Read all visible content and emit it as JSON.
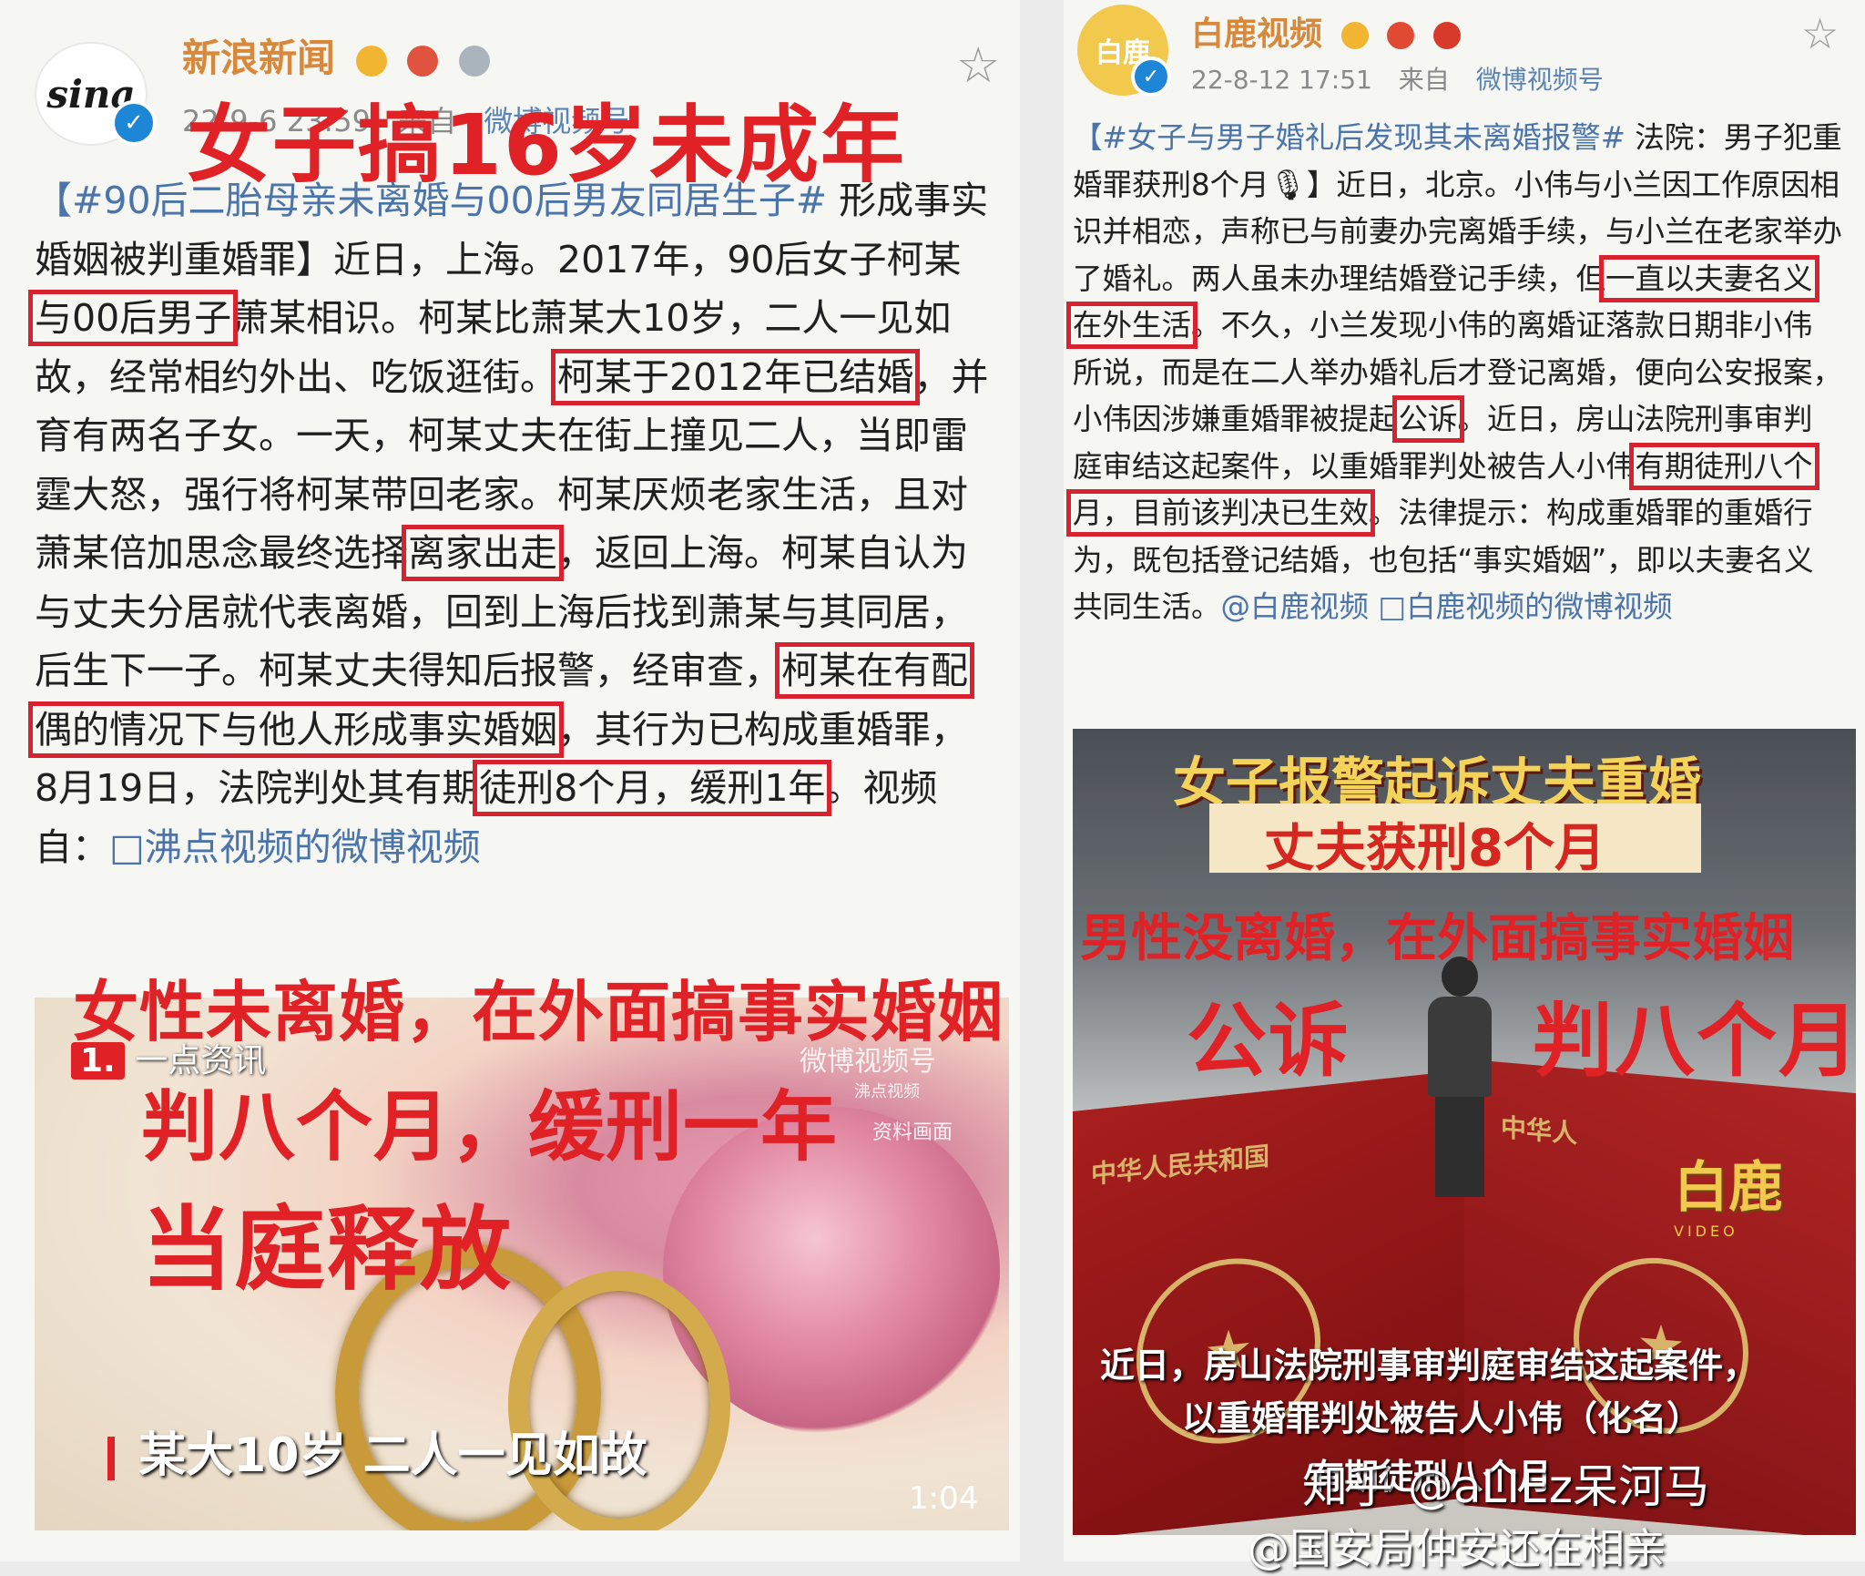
{
  "left_post": {
    "account_name": "新浪新闻",
    "avatar_logo_text": "sina",
    "meta_time": "22-9-6 23:59",
    "meta_from": "来自",
    "meta_source": "微博视频号",
    "overlay_title": "女子搞16岁未成年",
    "text_segments": [
      {
        "t": "【#90后二胎母亲未离婚与00后男友同居生子#",
        "cls": "tag"
      },
      {
        "t": " 形成事实婚姻被判重婚罪】近日，上海。2017年，90后女子柯某"
      },
      {
        "t": "与00后男子",
        "cls": "hl"
      },
      {
        "t": "萧某相识。柯某比萧某大10岁，二人一见如故，经常相约外出、吃饭逛街。"
      },
      {
        "t": "柯某于2012年已结婚",
        "cls": "hl"
      },
      {
        "t": "，并育有两名子女。一天，柯某丈夫在街上撞见二人，当即雷霆大怒，强行将柯某带回老家。柯某厌烦老家生活，且对萧某倍加思念最终选择"
      },
      {
        "t": "离家出走",
        "cls": "hl"
      },
      {
        "t": "，返回上海。柯某自认为与丈夫分居就代表离婚，回到上海后找到萧某与其同居，后生下一子。柯某丈夫得知后报警，经审查，"
      },
      {
        "t": "柯某在有配偶的情况下与他人形成事实婚姻",
        "cls": "hl"
      },
      {
        "t": "，其行为已构成重婚罪，8月19日，法院判处其有期"
      },
      {
        "t": "徒刑8个月，缓刑1年",
        "cls": "hl"
      },
      {
        "t": "。视频自："
      },
      {
        "t": "□沸点视频的微博视频",
        "cls": "link"
      }
    ],
    "overlay_1": "女性未离婚，在外面搞事实婚姻",
    "overlay_2": "判八个月，缓刑一年",
    "overlay_3": "当庭释放",
    "video": {
      "top_badge_num": "1.",
      "top_badge_text": "一点资讯",
      "watermark": "微博视频号",
      "watermark_sub": "沸点视频",
      "source_note": "资料画面",
      "subtitle": "某大10岁 二人一见如故",
      "duration": "1:04"
    }
  },
  "right_post": {
    "account_name": "白鹿视频",
    "avatar_logo_text": "白鹿",
    "meta_time": "22-8-12 17:51",
    "meta_from": "来自",
    "meta_source": "微博视频号",
    "text_segments": [
      {
        "t": "【#女子与男子婚礼后发现其未离婚报警#",
        "cls": "tag"
      },
      {
        "t": " 法院：男子犯重婚罪获刑8个月🎙】近日，北京。小伟与小兰因工作原因相识并相恋，声称已与前妻办完离婚手续，与小兰在老家举办了婚礼。两人虽未办理结婚登记手续，但"
      },
      {
        "t": "一直以夫妻名义在外生活",
        "cls": "hl"
      },
      {
        "t": "。不久，小兰发现小伟的离婚证落款日期非小伟所说，而是在二人举办婚礼后才登记离婚，便向公安报案，小伟因涉嫌重婚罪被提起"
      },
      {
        "t": "公诉",
        "cls": "hl"
      },
      {
        "t": "。近日，房山法院刑事审判庭审结这起案件，以重婚罪判处被告人小伟"
      },
      {
        "t": "有期徒刑八个月，目前该判决已生效",
        "cls": "hl"
      },
      {
        "t": "。法律提示：构成重婚罪的重婚行为，既包括登记结婚，也包括“事实婚姻”，即以夫妻名义共同生活。"
      },
      {
        "t": "@白鹿视频",
        "cls": "link"
      },
      {
        "t": " "
      },
      {
        "t": "□白鹿视频的微博视频",
        "cls": "link"
      }
    ],
    "video": {
      "title_line1": "女子报警起诉丈夫重婚",
      "title_line2": "丈夫获刑8个月",
      "book_left_text": "中华人民共和国",
      "book_right_text": "中华人",
      "logo_text": "白鹿",
      "logo_sub": "VIDEO",
      "caption_line1": "近日，房山法院刑事审判庭审结这起案件，",
      "caption_line2": "以重婚罪判处被告人小伟（化名）",
      "caption_line3": "有期徒刑八个月"
    },
    "overlay_1": "男性没离婚，在外面搞事实婚姻",
    "overlay_2": "公诉",
    "overlay_3": "判八个月"
  },
  "watermark": {
    "line1": "知乎 @aLIEz呆河马",
    "line2": "@国安局仲安还在相亲"
  },
  "colors": {
    "overlay_red": "#e02227",
    "highlight_box": "#d8222f",
    "hashtag_blue": "#4a74aa",
    "account_orange": "#d8883a"
  }
}
